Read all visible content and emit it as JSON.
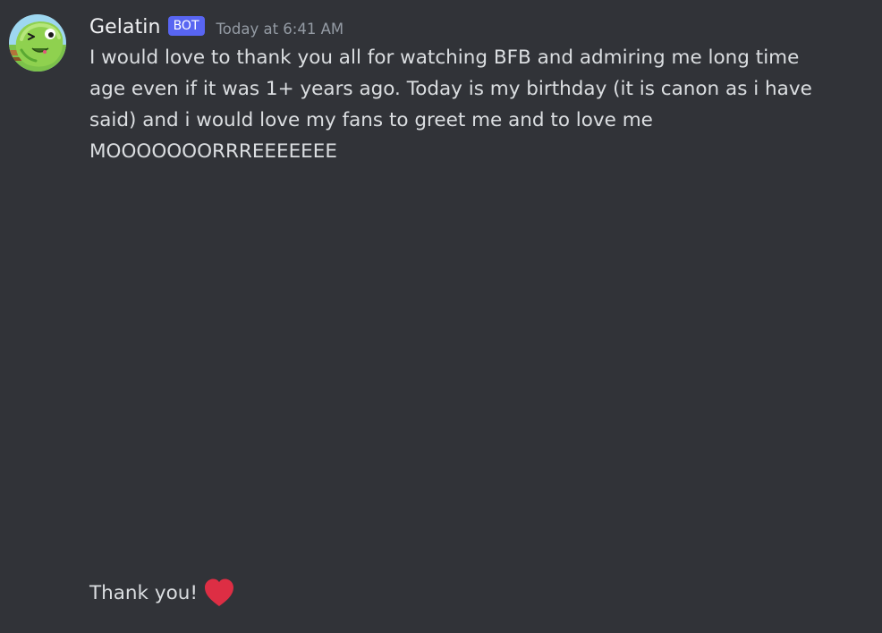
{
  "message": {
    "username": "Gelatin",
    "bot_tag": "BOT",
    "timestamp": "Today at 6:41 AM",
    "lines": [
      "I would love to thank you all for watching BFB and admiring me long time",
      "age even if it was 1+ years ago. Today is my birthday (it is canon as i have",
      "said) and i would love my fans to greet me and to love me",
      "MOOOOOOORRREEEEEEE"
    ],
    "closing_text": "Thank you!",
    "closing_icon": "red-heart-emoji"
  },
  "colors": {
    "background": "#313338",
    "username": "#f2f3f5",
    "bot_tag_bg": "#5865f2",
    "timestamp": "#949ba4",
    "text": "#dbdee1",
    "heart": "#dd2e44"
  }
}
